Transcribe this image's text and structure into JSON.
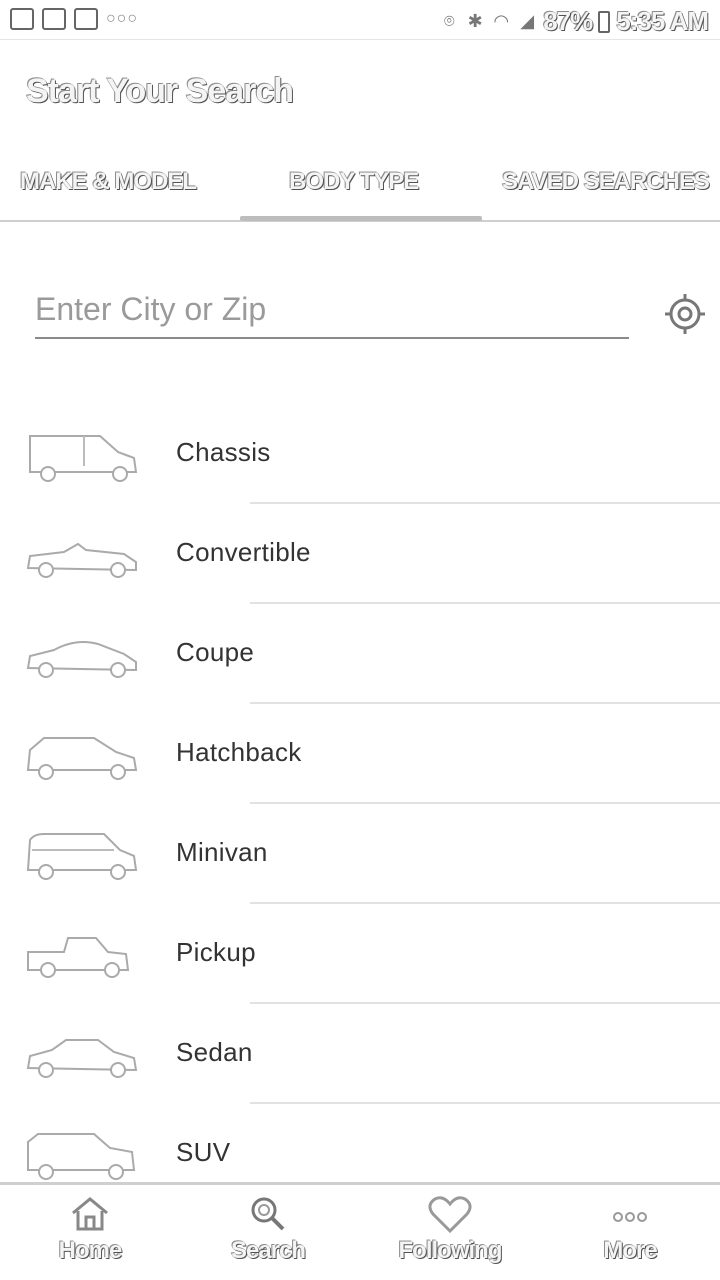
{
  "status_bar": {
    "battery": "87%",
    "time": "5:35 AM"
  },
  "header": {
    "title": "Start Your Search"
  },
  "tabs": [
    {
      "label": "MAKE & MODEL"
    },
    {
      "label": "BODY TYPE"
    },
    {
      "label": "SAVED SEARCHES"
    }
  ],
  "location": {
    "placeholder": "Enter City or Zip"
  },
  "body_types": [
    {
      "label": "Chassis",
      "icon": "van-icon"
    },
    {
      "label": "Convertible",
      "icon": "convertible-icon"
    },
    {
      "label": "Coupe",
      "icon": "coupe-icon"
    },
    {
      "label": "Hatchback",
      "icon": "hatchback-icon"
    },
    {
      "label": "Minivan",
      "icon": "minivan-icon"
    },
    {
      "label": "Pickup",
      "icon": "pickup-icon"
    },
    {
      "label": "Sedan",
      "icon": "sedan-icon"
    },
    {
      "label": "SUV",
      "icon": "suv-icon"
    }
  ],
  "bottom_nav": [
    {
      "label": "Home",
      "icon": "home-icon"
    },
    {
      "label": "Search",
      "icon": "search-icon"
    },
    {
      "label": "Following",
      "icon": "heart-icon"
    },
    {
      "label": "More",
      "icon": "more-dots-icon"
    }
  ]
}
